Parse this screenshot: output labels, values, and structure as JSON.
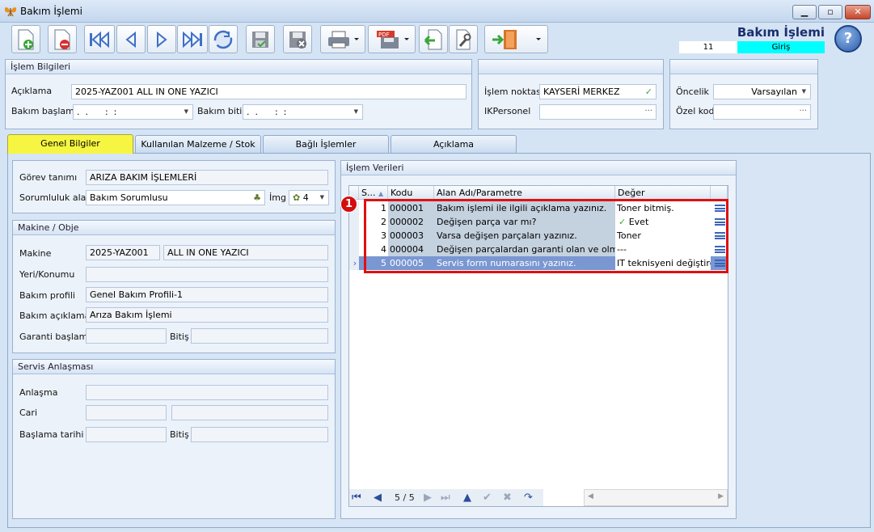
{
  "window": {
    "title": "Bakım İşlemi",
    "icon": "butterfly-icon",
    "controls": [
      "minimize-icon",
      "maximize-icon",
      "close-icon"
    ]
  },
  "toolbar": {
    "buttons": [
      "new-document-icon",
      "delete-document-icon",
      "first-record-icon",
      "previous-record-icon",
      "next-record-icon",
      "last-record-icon",
      "refresh-icon",
      "save-icon",
      "cancel-save-icon",
      "print-icon",
      "pdf-export-icon",
      "import-icon",
      "tools-icon",
      "exit-icon"
    ]
  },
  "header": {
    "form_title": "Bakım İşlemi",
    "record_no": "11",
    "mode": "Giriş",
    "mode_color": "#00ffff"
  },
  "islem_bilgileri": {
    "title": "İşlem Bilgileri",
    "aciklama_label": "Açıklama",
    "aciklama_value": "2025-YAZ001 ALL IN ONE YAZICI",
    "bakim_baslama_label": "Bakım başlama",
    "bakim_baslama_value": ".  .      :  :",
    "bakim_bitis_label": "Bakım bitiş",
    "bakim_bitis_value": ".  .      :  :"
  },
  "islem_noktasi": {
    "label": "İşlem noktası",
    "value": "KAYSERİ MERKEZ",
    "ikpersonel_label": "IKPersonel",
    "ikpersonel_value": ""
  },
  "oncelik": {
    "label": "Öncelik",
    "value": "Varsayılan",
    "ozel_kod_label": "Özel kod",
    "ozel_kod_value": ""
  },
  "tabs": [
    {
      "label": "Genel Bilgiler",
      "active": true
    },
    {
      "label": "Kullanılan Malzeme / Stok",
      "active": false
    },
    {
      "label": "Bağlı İşlemler",
      "active": false
    },
    {
      "label": "Açıklama",
      "active": false
    }
  ],
  "gorev": {
    "gorev_tanimi_label": "Görev tanımı",
    "gorev_tanimi_value": "ARIZA BAKIM İŞLEMLERİ",
    "sorumluluk_label": "Sorumluluk alanı",
    "sorumluluk_value": "Bakım Sorumlusu",
    "img_label": "İmg",
    "img_value": "4"
  },
  "makine": {
    "title": "Makine / Obje",
    "makine_label": "Makine",
    "makine_code": "2025-YAZ001",
    "makine_name": "ALL IN ONE YAZICI",
    "yeri_label": "Yeri/Konumu",
    "yeri_value": "",
    "bakim_profili_label": "Bakım profili",
    "bakim_profili_value": "Genel Bakım Profili-1",
    "bakim_aciklama_label": "Bakım açıklama",
    "bakim_aciklama_value": "Arıza Bakım İşlemi",
    "garanti_label": "Garanti başlama",
    "bitis_label": "Bitiş"
  },
  "servis": {
    "title": "Servis Anlaşması",
    "anlasma_label": "Anlaşma",
    "cari_label": "Cari",
    "baslama_tarihi_label": "Başlama tarihi",
    "bitis_label": "Bitiş"
  },
  "islem_verileri": {
    "title": "İşlem Verileri",
    "columns": [
      "S...",
      "Kodu",
      "Alan Adı/Parametre",
      "Değer"
    ],
    "rows": [
      {
        "no": "1",
        "code": "000001",
        "name": "Bakım işlemi ile ilgili açıklama yazınız.",
        "value": "Toner bitmiş."
      },
      {
        "no": "2",
        "code": "000002",
        "name": "Değişen parça var mı?",
        "value": "Evet",
        "checked": true
      },
      {
        "no": "3",
        "code": "000003",
        "name": "Varsa değişen parçaları yazınız.",
        "value": "Toner"
      },
      {
        "no": "4",
        "code": "000004",
        "name": "Değişen parçalardan garanti olan ve olmayanla",
        "value": "---"
      },
      {
        "no": "5",
        "code": "000005",
        "name": "Servis form numarasını yazınız.",
        "value": "IT teknisyeni değiştirdi.",
        "selected": true
      }
    ],
    "navigator_position": "5 / 5",
    "marker": "1",
    "highlight_color": "#e01010"
  }
}
